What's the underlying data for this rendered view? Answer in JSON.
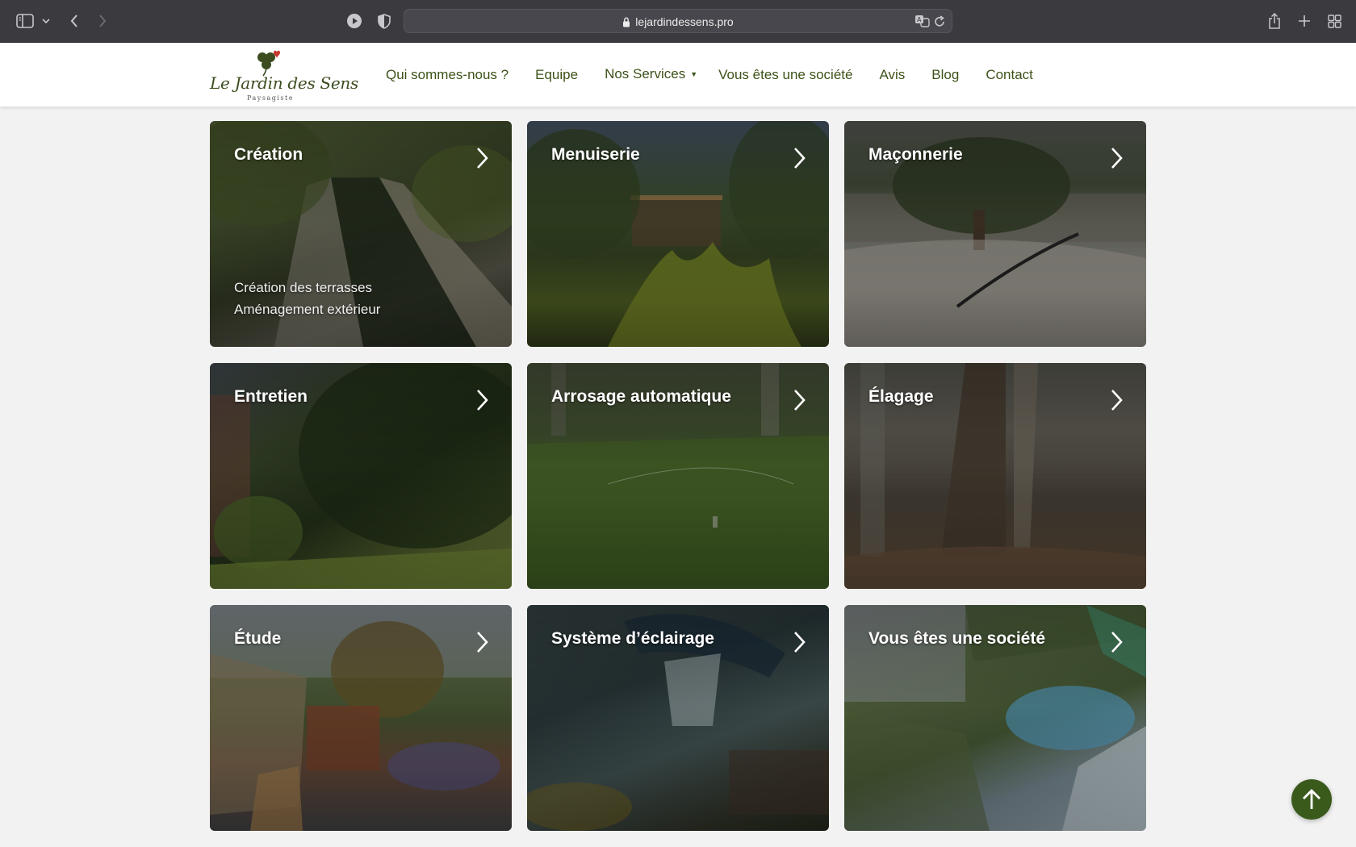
{
  "browser": {
    "url": "lejardindessens.pro"
  },
  "site": {
    "logo": {
      "name": "Le Jardin des Sens",
      "tagline": "Paysagiste",
      "clover_colors": [
        "#3b4d1f",
        "#c8372d"
      ]
    },
    "nav": [
      {
        "label": "Qui sommes-nous ?",
        "dropdown": false
      },
      {
        "label": "Equipe",
        "dropdown": false
      },
      {
        "label": "Nos Services",
        "dropdown": true
      },
      {
        "label": "Vous êtes une société",
        "dropdown": false
      },
      {
        "label": "Avis",
        "dropdown": false
      },
      {
        "label": "Blog",
        "dropdown": false
      },
      {
        "label": "Contact",
        "dropdown": false
      }
    ],
    "accent_color": "#3d5219"
  },
  "services": [
    {
      "title": "Création",
      "icon": "chevron-right-icon",
      "details": [
        "Création des terrasses",
        "Aménagement extérieur"
      ]
    },
    {
      "title": "Menuiserie",
      "icon": "chevron-right-icon",
      "details": []
    },
    {
      "title": "Maçonnerie",
      "icon": "chevron-right-icon",
      "details": []
    },
    {
      "title": "Entretien",
      "icon": "chevron-right-icon",
      "details": []
    },
    {
      "title": "Arrosage automatique",
      "icon": "chevron-right-icon",
      "details": []
    },
    {
      "title": "Élagage",
      "icon": "chevron-right-icon",
      "details": []
    },
    {
      "title": "Étude",
      "icon": "chevron-right-icon",
      "details": []
    },
    {
      "title": "Système d’éclairage",
      "icon": "chevron-right-icon",
      "details": []
    },
    {
      "title": "Vous êtes une société",
      "icon": "chevron-right-icon",
      "details": []
    }
  ],
  "scroll_top": {
    "icon": "arrow-up-icon"
  }
}
